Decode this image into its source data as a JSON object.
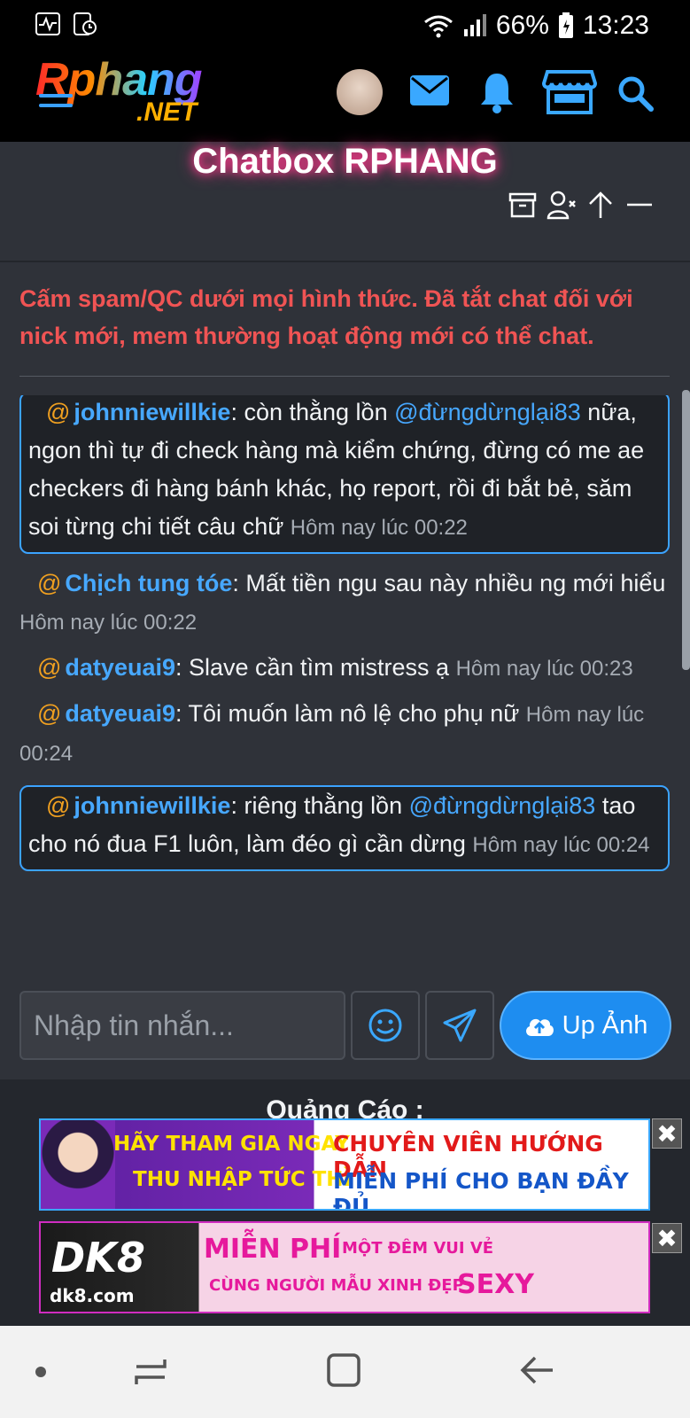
{
  "status_bar": {
    "battery": "66%",
    "time": "13:23"
  },
  "logo": {
    "line1": "Rphang",
    "line2": ".NET"
  },
  "chat": {
    "title": "Chatbox RPHANG",
    "notice": "Cấm spam/QC dưới mọi hình thức. Đã tắt chat đối với nick mới, mem thường hoạt động mới có thể chat.",
    "messages": [
      {
        "boxed": true,
        "at": "@",
        "user": "johnniewillkie",
        "text_before": ": còn thằng lồn ",
        "mention": "@đừngdừnglại83",
        "text_after": " nữa, ngon thì tự đi check hàng mà kiểm chứng, đừng có me ae checkers đi hàng bánh khác, họ report, rồi đi bắt bẻ, săm soi từng chi tiết câu chữ ",
        "time": "Hôm nay lúc 00:22"
      },
      {
        "boxed": false,
        "at": "@",
        "user": "Chịch tung tóe",
        "text_before": ": Mất tiền ngu sau này nhiều ng mới hiểu ",
        "mention": "",
        "text_after": "",
        "time": "Hôm nay lúc 00:22"
      },
      {
        "boxed": false,
        "at": "@",
        "user": "datyeuai9",
        "text_before": ": Slave cần tìm mistress ạ ",
        "mention": "",
        "text_after": "",
        "time": "Hôm nay lúc 00:23"
      },
      {
        "boxed": false,
        "at": "@",
        "user": "datyeuai9",
        "text_before": ": Tôi muốn làm nô lệ cho phụ nữ ",
        "mention": "",
        "text_after": "",
        "time": "Hôm nay lúc 00:24"
      },
      {
        "boxed": true,
        "at": "@",
        "user": "johnniewillkie",
        "text_before": ": riêng thằng lồn ",
        "mention": "@đừngdừnglại83",
        "text_after": " tao cho nó đua F1 luôn, làm đéo gì cần dừng ",
        "time": "Hôm nay lúc 00:24"
      }
    ],
    "input_placeholder": "Nhập tin nhắn...",
    "upload_label": "Up Ảnh"
  },
  "ads": {
    "title": "Quảng Cáo :",
    "ad1": {
      "left_top": "HÃY THAM GIA NGAY",
      "left_bottom": "THU NHẬP TỨC THÌ",
      "right_top": "CHUYÊN VIÊN HƯỚNG DẪN",
      "right_bottom": "MIỄN PHÍ CHO BẠN ĐẦY ĐỦ"
    },
    "ad2": {
      "brand": "DK8",
      "domain": "dk8.com",
      "line1": "MIỄN PHÍ",
      "line1b": "MỘT ĐÊM VUI VẺ",
      "line2": "CÙNG NGƯỜI MẪU XINH ĐẸP",
      "line2b": "SEXY"
    },
    "close_glyph": "✖"
  },
  "colors": {
    "accent": "#1e8df0",
    "username": "#47a8ff",
    "notice": "#f05454",
    "at_sign": "#f0a020"
  }
}
